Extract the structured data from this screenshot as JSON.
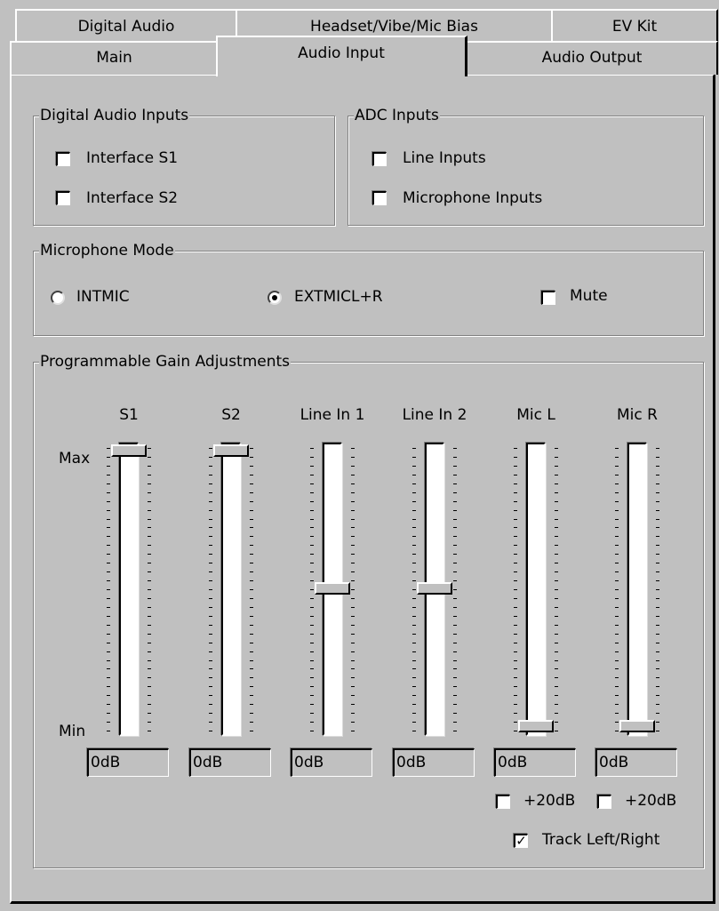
{
  "tabs_back": [
    "Digital Audio",
    "Headset/Vibe/Mic Bias",
    "EV Kit"
  ],
  "tabs_front": [
    "Main",
    "Audio Input",
    "Audio Output"
  ],
  "active_tab": "Audio Input",
  "digital_audio_inputs": {
    "title": "Digital Audio Inputs",
    "items": [
      {
        "label": "Interface S1",
        "checked": false
      },
      {
        "label": "Interface S2",
        "checked": false
      }
    ]
  },
  "adc_inputs": {
    "title": "ADC Inputs",
    "items": [
      {
        "label": "Line Inputs",
        "checked": false
      },
      {
        "label": "Microphone Inputs",
        "checked": false
      }
    ]
  },
  "microphone_mode": {
    "title": "Microphone Mode",
    "options": [
      {
        "label": "INTMIC",
        "selected": false
      },
      {
        "label": "EXTMICL+R",
        "selected": true
      }
    ],
    "mute": {
      "label": "Mute",
      "checked": false
    }
  },
  "gain": {
    "title": "Programmable Gain Adjustments",
    "max_label": "Max",
    "min_label": "Min",
    "channels": [
      {
        "label": "S1",
        "value": "0dB",
        "level": 1.0
      },
      {
        "label": "S2",
        "value": "0dB",
        "level": 1.0
      },
      {
        "label": "Line In 1",
        "value": "0dB",
        "level": 0.5
      },
      {
        "label": "Line In 2",
        "value": "0dB",
        "level": 0.5
      },
      {
        "label": "Mic L",
        "value": "0dB",
        "level": 0.0,
        "boost_label": "+20dB",
        "boost_checked": false
      },
      {
        "label": "Mic R",
        "value": "0dB",
        "level": 0.0,
        "boost_label": "+20dB",
        "boost_checked": false
      }
    ],
    "track": {
      "label": "Track Left/Right",
      "checked": true
    }
  },
  "check_glyph": "✓"
}
